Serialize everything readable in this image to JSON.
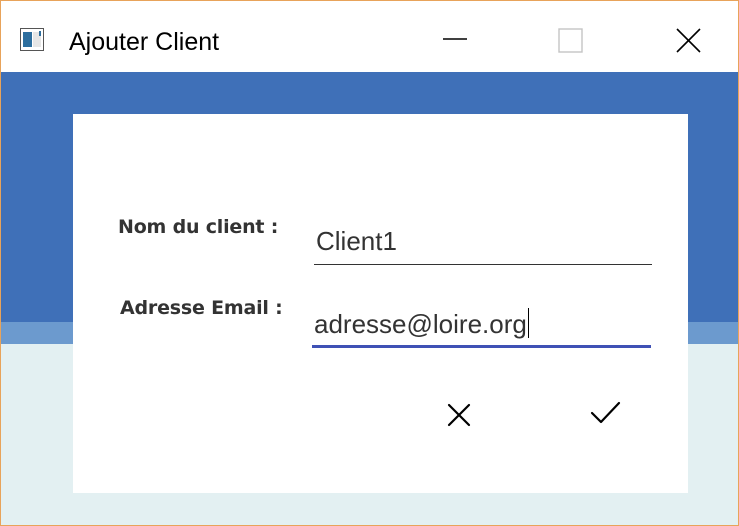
{
  "window": {
    "title": "Ajouter Client",
    "controls": [
      "minimize-icon",
      "maximize-icon",
      "close-icon"
    ]
  },
  "form": {
    "name_label": "Nom du client :",
    "name_value": "Client1",
    "email_label": "Adresse Email :",
    "email_value": "adresse@loire.org"
  },
  "actions": {
    "cancel_icon": "close-icon",
    "confirm_icon": "check-icon"
  },
  "colors": {
    "header_blue": "#3f70b8",
    "band_light_blue": "#6c9ace",
    "background": "#e3f0f2",
    "focus_underline": "#3f51b5",
    "window_border": "#e8a35a"
  }
}
